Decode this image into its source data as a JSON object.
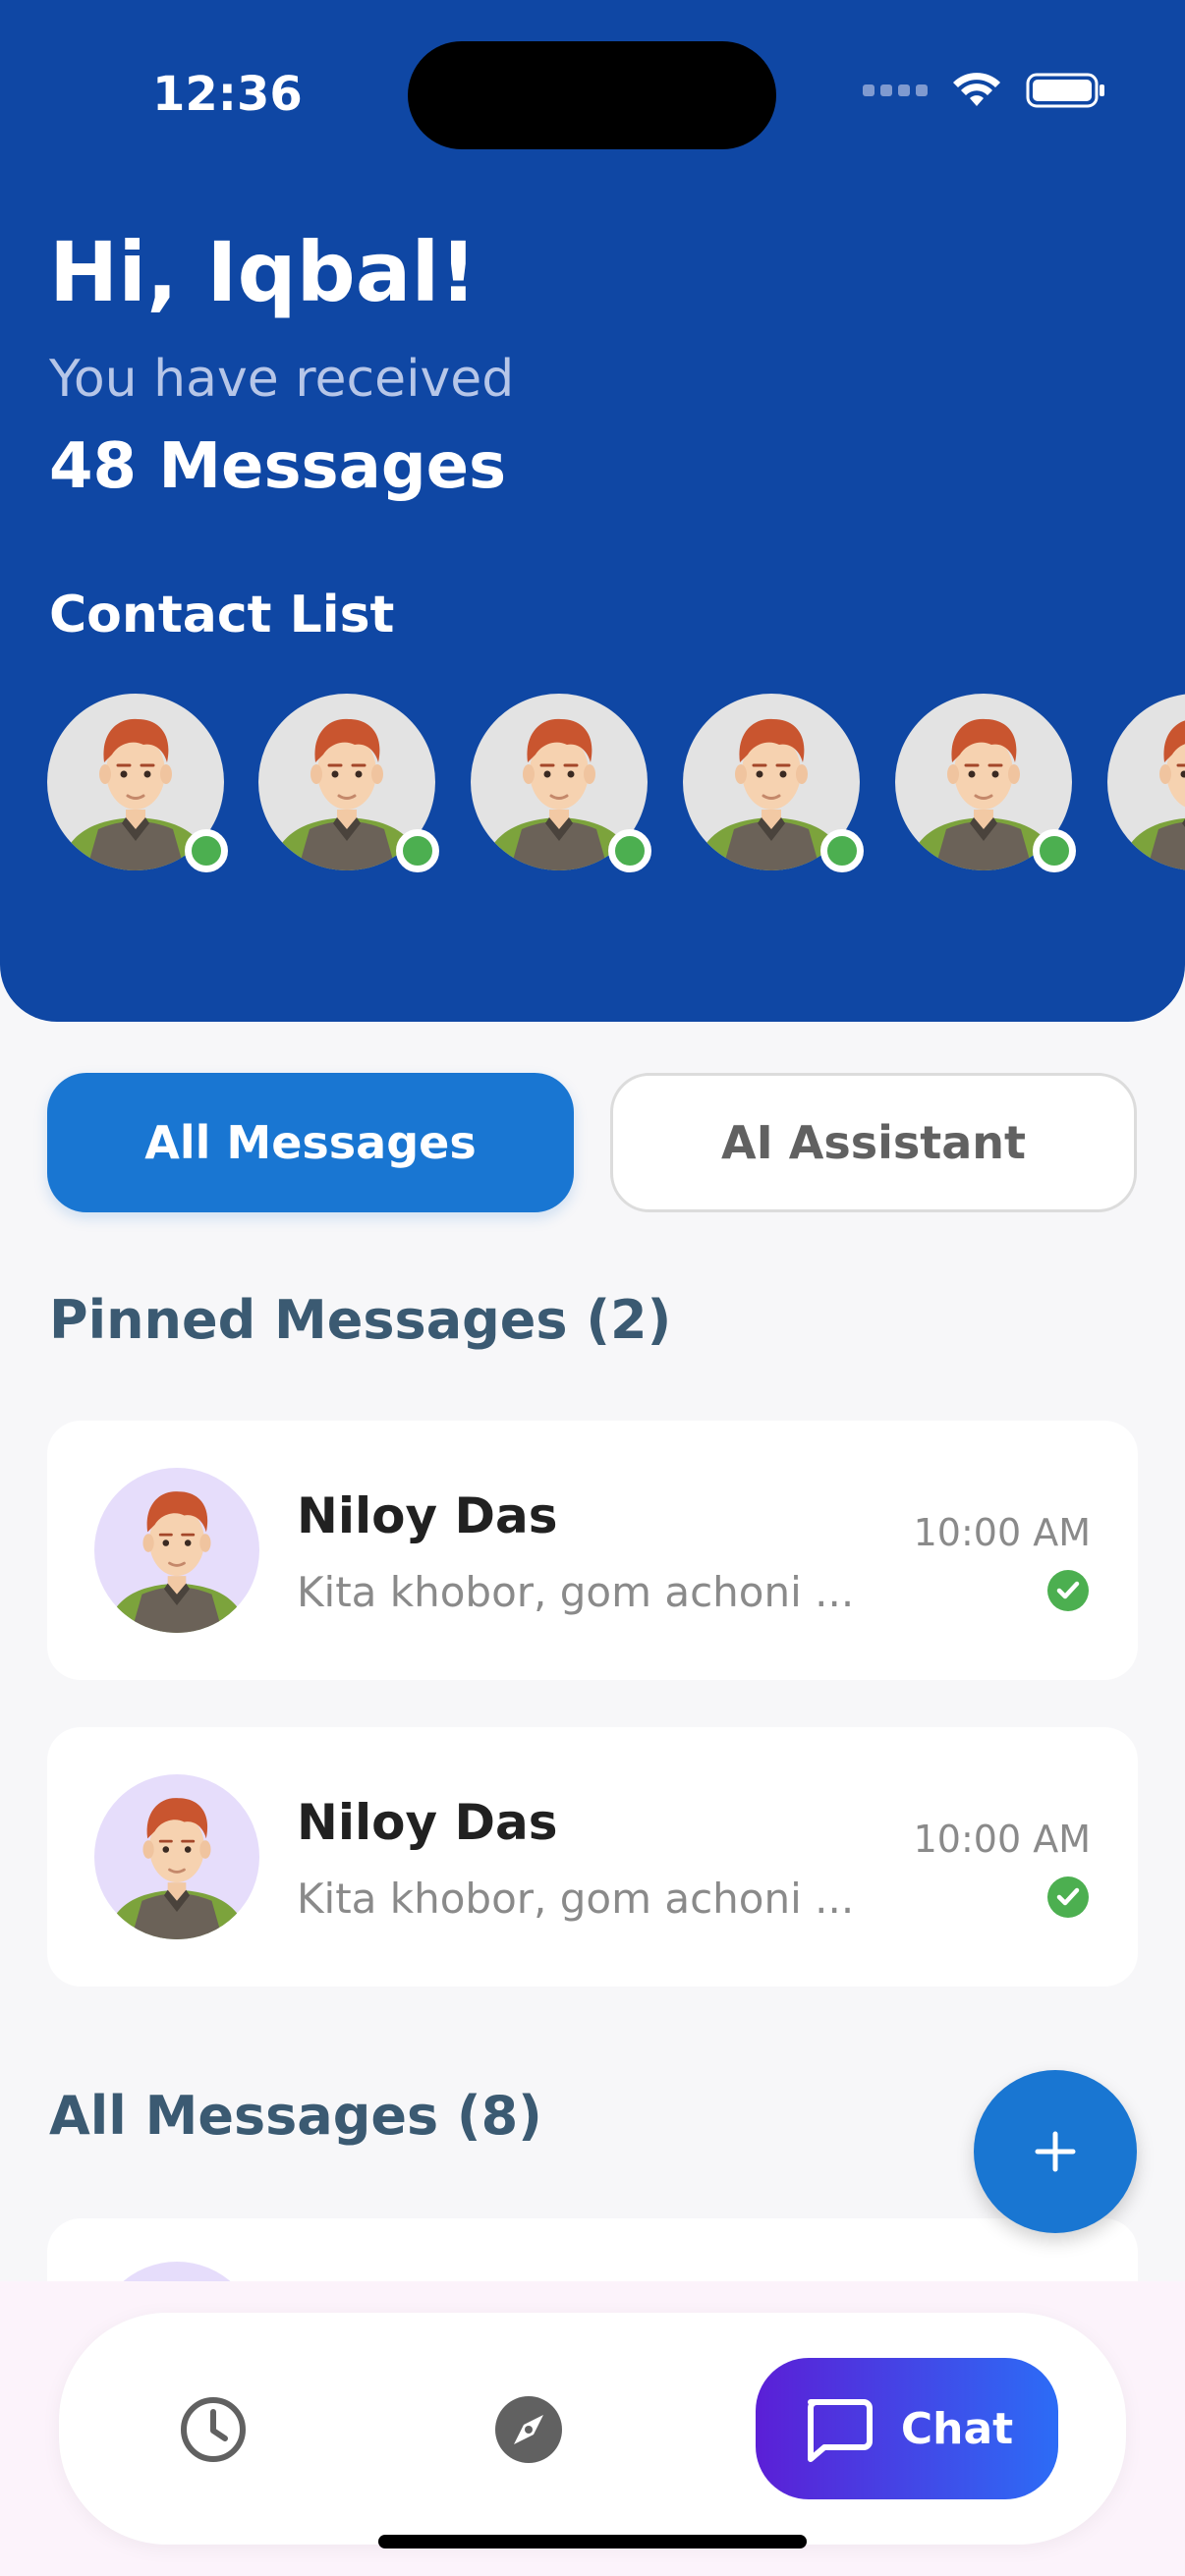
{
  "status_bar": {
    "time": "12:36"
  },
  "header": {
    "greeting": "Hi, Iqbal!",
    "received_label": "You have received",
    "message_count": "48 Messages",
    "contacts_title": "Contact List"
  },
  "colors": {
    "header_bg": "#0f47a4",
    "accent": "#1976d2",
    "online": "#4caf50",
    "chat_gradient": [
      "#5b1fd6",
      "#2c6cf6"
    ]
  },
  "tabs": {
    "all_messages": "All Messages",
    "ai_assistant": "AI Assistant"
  },
  "pinned": {
    "title": "Pinned Messages (2)",
    "items": [
      {
        "name": "Niloy Das",
        "preview": "Kita khobor, gom achoni ...",
        "time": "10:00 AM"
      },
      {
        "name": "Niloy Das",
        "preview": "Kita khobor, gom achoni ...",
        "time": "10:00 AM"
      }
    ]
  },
  "all_messages": {
    "title": "All Messages (8)"
  },
  "nav": {
    "chat_label": "Chat",
    "icons": [
      "history-icon",
      "explore-icon",
      "chat-icon"
    ]
  }
}
